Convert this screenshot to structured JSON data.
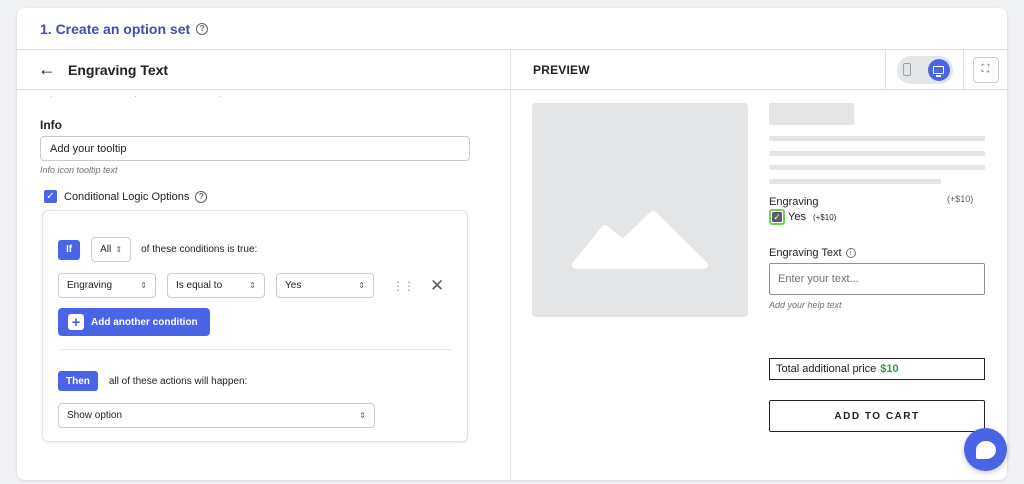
{
  "header": {
    "title": "1. Create an option set",
    "help_icon": "question-circle-icon"
  },
  "editor": {
    "back_icon": "arrow-left-icon",
    "title": "Engraving Text",
    "info": {
      "label": "Info",
      "value": "Add your tooltip",
      "help": "Info icon tooltip text"
    },
    "conditional": {
      "checked": true,
      "label": "Conditional Logic Options"
    },
    "if_tag": "If",
    "match_select": "All",
    "match_text": "of these conditions is true:",
    "condition": {
      "field": "Engraving",
      "operator": "Is equal to",
      "value": "Yes"
    },
    "add_condition_label": "Add another condition",
    "then_tag": "Then",
    "then_text": "all of these actions will happen:",
    "action_select": "Show option"
  },
  "preview": {
    "label": "PREVIEW",
    "device_active": "desktop",
    "accent": "#4a64e8",
    "option_name": "Engraving",
    "option_price": "(+$10)",
    "choice_label": "Yes",
    "choice_price": "(+$10)",
    "choice_checked": true,
    "text_label": "Engraving Text",
    "text_placeholder": "Enter your text...",
    "text_help": "Add your help text",
    "total_label": "Total additional price",
    "total_value": "$10",
    "cart_label": "ADD TO CART",
    "price_color": "#2e9e45"
  }
}
